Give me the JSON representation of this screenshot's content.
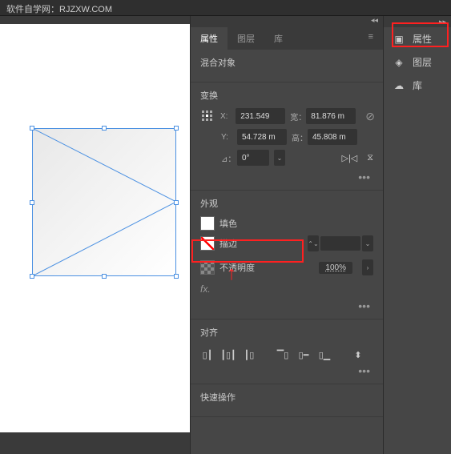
{
  "watermark": "软件自学网：RJZXW.COM",
  "panel": {
    "tabs": [
      "属性",
      "图层",
      "库"
    ],
    "blend_section": "混合对象",
    "transform": {
      "title": "变换",
      "x": "231.549",
      "y": "54.728 m",
      "w": "81.876 m",
      "h": "45.808 m",
      "x_label": "X:",
      "y_label": "Y:",
      "w_label": "宽：",
      "h_label": "高：",
      "angle": "0°",
      "angle_label": "⊿："
    },
    "appearance": {
      "title": "外观",
      "fill": "填色",
      "stroke": "描边",
      "opacity_label": "不透明度",
      "opacity_value": "100%"
    },
    "align": {
      "title": "对齐"
    },
    "quick": {
      "title": "快速操作"
    }
  },
  "sidebar": {
    "items": [
      "属性",
      "图层",
      "库"
    ]
  }
}
